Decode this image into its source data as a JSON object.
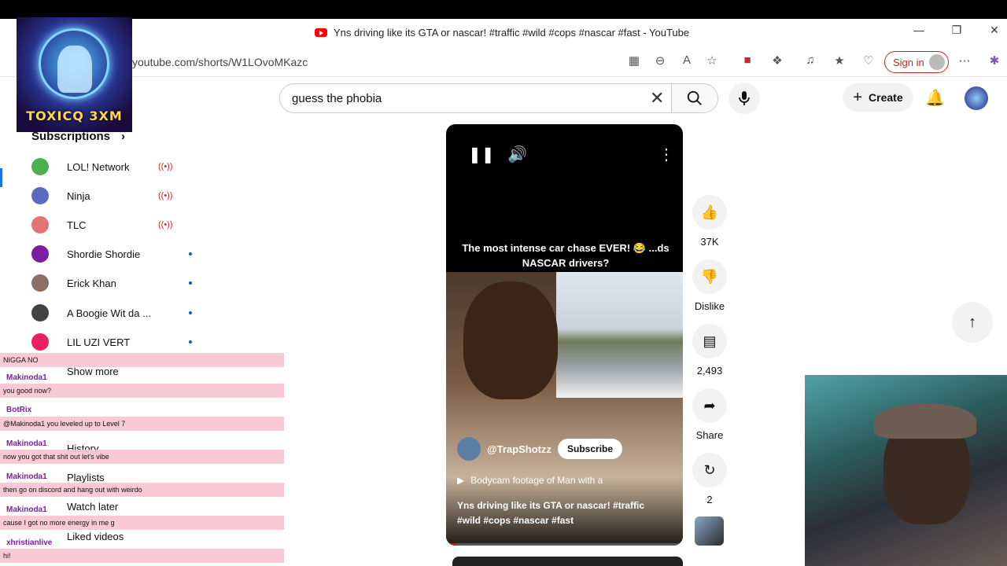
{
  "browser": {
    "tab_title": "Yns driving like its GTA or nascar! #traffic #wild #cops #nascar #fast - YouTube",
    "url": "youtube.com/shorts/W1LOvoMKazc",
    "sign_in_label": "Sign in"
  },
  "overlay_logo": {
    "text": "TOXICQ 3XM"
  },
  "search": {
    "query": "guess the phobia"
  },
  "header": {
    "create_label": "Create"
  },
  "sidebar": {
    "subscriptions_label": "Subscriptions",
    "subscriptions": [
      {
        "name": "LOL! Network",
        "status": "live",
        "color": "#4caf50"
      },
      {
        "name": "Ninja",
        "status": "live",
        "color": "#5c6bc0"
      },
      {
        "name": "TLC",
        "status": "live",
        "color": "#e57373"
      },
      {
        "name": "Shordie Shordie",
        "status": "new",
        "color": "#7b1fa2"
      },
      {
        "name": "Erick Khan",
        "status": "new",
        "color": "#8d6e63"
      },
      {
        "name": "A Boogie Wit da ...",
        "status": "new",
        "color": "#424242"
      },
      {
        "name": "LIL UZI VERT",
        "status": "new",
        "color": "#e91e63"
      }
    ],
    "show_more": "Show more",
    "items": [
      "History",
      "Playlists",
      "Watch later",
      "Liked videos"
    ]
  },
  "chat": {
    "messages": [
      {
        "user": "",
        "text": "NIGGA NO"
      },
      {
        "user": "Makinoda1",
        "text": "you good now?"
      },
      {
        "user": "BotRix",
        "text": "@Makinoda1 you leveled up to Level 7"
      },
      {
        "user": "Makinoda1",
        "text": "now you got that shit out let's vibe"
      },
      {
        "user": "Makinoda1",
        "text": "then go on discord and hang out with weirdo"
      },
      {
        "user": "Makinoda1",
        "text": "cause I got no more energy in me g"
      },
      {
        "user": "xhristianlive",
        "text": "hi!"
      }
    ]
  },
  "short": {
    "caption": "The most intense car chase EVER! 😂 ...ds NASCAR drivers?",
    "channel": "@TrapShotzz",
    "subscribe_label": "Subscribe",
    "related": "Bodycam footage of Man with a",
    "title": "Yns driving like its GTA or nascar! #traffic #wild #cops #nascar #fast",
    "progress": 0.04
  },
  "actions": {
    "likes": "37K",
    "dislike_label": "Dislike",
    "comments": "2,493",
    "share_label": "Share",
    "remix_count": "2"
  },
  "icons": [
    "pause-icon",
    "volume-icon",
    "more-icon",
    "like-icon",
    "dislike-icon",
    "comment-icon",
    "share-icon",
    "remix-icon",
    "search-icon",
    "mic-icon",
    "bell-icon",
    "arrow-up-icon"
  ]
}
